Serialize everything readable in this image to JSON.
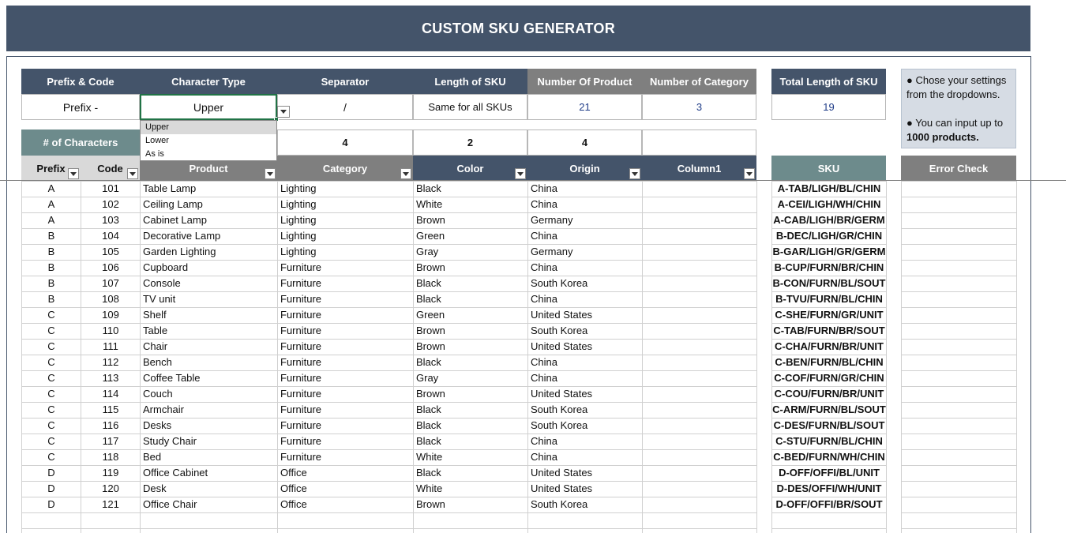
{
  "title": "CUSTOM SKU GENERATOR",
  "settings": {
    "headers": [
      "Prefix & Code",
      "Character Type",
      "Separator",
      "Length of SKU",
      "Number Of Product",
      "Number of Category"
    ],
    "values": [
      "Prefix -",
      "Upper",
      "/",
      "Same for all SKUs",
      "21",
      "3"
    ],
    "total_header": "Total Length of SKU",
    "total_value": "19"
  },
  "info": {
    "line1": "● Chose your settings from the dropdowns.",
    "line2_prefix": "● You can input up to ",
    "line2_bold": "1000 products."
  },
  "dropdown": {
    "options": [
      "Upper",
      "Lower",
      "As is"
    ],
    "selected": "Upper"
  },
  "chars_row": {
    "label": "# of Characters",
    "values": [
      "4",
      "2",
      "4"
    ]
  },
  "table": {
    "headers": [
      "Prefix",
      "Code",
      "Product",
      "Category",
      "Color",
      "Origin",
      "Column1"
    ],
    "sku_header": "SKU",
    "error_header": "Error Check",
    "rows": [
      {
        "prefix": "A",
        "code": "101",
        "product": "Table Lamp",
        "category": "Lighting",
        "color": "Black",
        "origin": "China",
        "sku": "A-TAB/LIGH/BL/CHIN"
      },
      {
        "prefix": "A",
        "code": "102",
        "product": "Ceiling Lamp",
        "category": "Lighting",
        "color": "White",
        "origin": "China",
        "sku": "A-CEI/LIGH/WH/CHIN"
      },
      {
        "prefix": "A",
        "code": "103",
        "product": "Cabinet Lamp",
        "category": "Lighting",
        "color": "Brown",
        "origin": "Germany",
        "sku": "A-CAB/LIGH/BR/GERM"
      },
      {
        "prefix": "B",
        "code": "104",
        "product": "Decorative Lamp",
        "category": "Lighting",
        "color": "Green",
        "origin": "China",
        "sku": "B-DEC/LIGH/GR/CHIN"
      },
      {
        "prefix": "B",
        "code": "105",
        "product": "Garden Lighting",
        "category": "Lighting",
        "color": "Gray",
        "origin": "Germany",
        "sku": "B-GAR/LIGH/GR/GERM"
      },
      {
        "prefix": "B",
        "code": "106",
        "product": "Cupboard",
        "category": "Furniture",
        "color": "Brown",
        "origin": "China",
        "sku": "B-CUP/FURN/BR/CHIN"
      },
      {
        "prefix": "B",
        "code": "107",
        "product": "Console",
        "category": "Furniture",
        "color": "Black",
        "origin": "South Korea",
        "sku": "B-CON/FURN/BL/SOUT"
      },
      {
        "prefix": "B",
        "code": "108",
        "product": "TV unit",
        "category": "Furniture",
        "color": "Black",
        "origin": "China",
        "sku": "B-TVU/FURN/BL/CHIN"
      },
      {
        "prefix": "C",
        "code": "109",
        "product": "Shelf",
        "category": "Furniture",
        "color": "Green",
        "origin": "United States",
        "sku": "C-SHE/FURN/GR/UNIT"
      },
      {
        "prefix": "C",
        "code": "110",
        "product": "Table",
        "category": "Furniture",
        "color": "Brown",
        "origin": "South Korea",
        "sku": "C-TAB/FURN/BR/SOUT"
      },
      {
        "prefix": "C",
        "code": "111",
        "product": "Chair",
        "category": "Furniture",
        "color": "Brown",
        "origin": "United States",
        "sku": "C-CHA/FURN/BR/UNIT"
      },
      {
        "prefix": "C",
        "code": "112",
        "product": "Bench",
        "category": "Furniture",
        "color": "Black",
        "origin": "China",
        "sku": "C-BEN/FURN/BL/CHIN"
      },
      {
        "prefix": "C",
        "code": "113",
        "product": "Coffee Table",
        "category": "Furniture",
        "color": "Gray",
        "origin": "China",
        "sku": "C-COF/FURN/GR/CHIN"
      },
      {
        "prefix": "C",
        "code": "114",
        "product": "Couch",
        "category": "Furniture",
        "color": "Brown",
        "origin": "United States",
        "sku": "C-COU/FURN/BR/UNIT"
      },
      {
        "prefix": "C",
        "code": "115",
        "product": "Armchair",
        "category": "Furniture",
        "color": "Black",
        "origin": "South Korea",
        "sku": "C-ARM/FURN/BL/SOUT"
      },
      {
        "prefix": "C",
        "code": "116",
        "product": "Desks",
        "category": "Furniture",
        "color": "Black",
        "origin": "South Korea",
        "sku": "C-DES/FURN/BL/SOUT"
      },
      {
        "prefix": "C",
        "code": "117",
        "product": "Study Chair",
        "category": "Furniture",
        "color": "Black",
        "origin": "China",
        "sku": "C-STU/FURN/BL/CHIN"
      },
      {
        "prefix": "C",
        "code": "118",
        "product": "Bed",
        "category": "Furniture",
        "color": "White",
        "origin": "China",
        "sku": "C-BED/FURN/WH/CHIN"
      },
      {
        "prefix": "D",
        "code": "119",
        "product": "Office Cabinet",
        "category": "Office",
        "color": "Black",
        "origin": "United States",
        "sku": "D-OFF/OFFI/BL/UNIT"
      },
      {
        "prefix": "D",
        "code": "120",
        "product": "Desk",
        "category": "Office",
        "color": "White",
        "origin": "United States",
        "sku": "D-DES/OFFI/WH/UNIT"
      },
      {
        "prefix": "D",
        "code": "121",
        "product": "Office Chair",
        "category": "Office",
        "color": "Brown",
        "origin": "South Korea",
        "sku": "D-OFF/OFFI/BR/SOUT"
      }
    ]
  }
}
